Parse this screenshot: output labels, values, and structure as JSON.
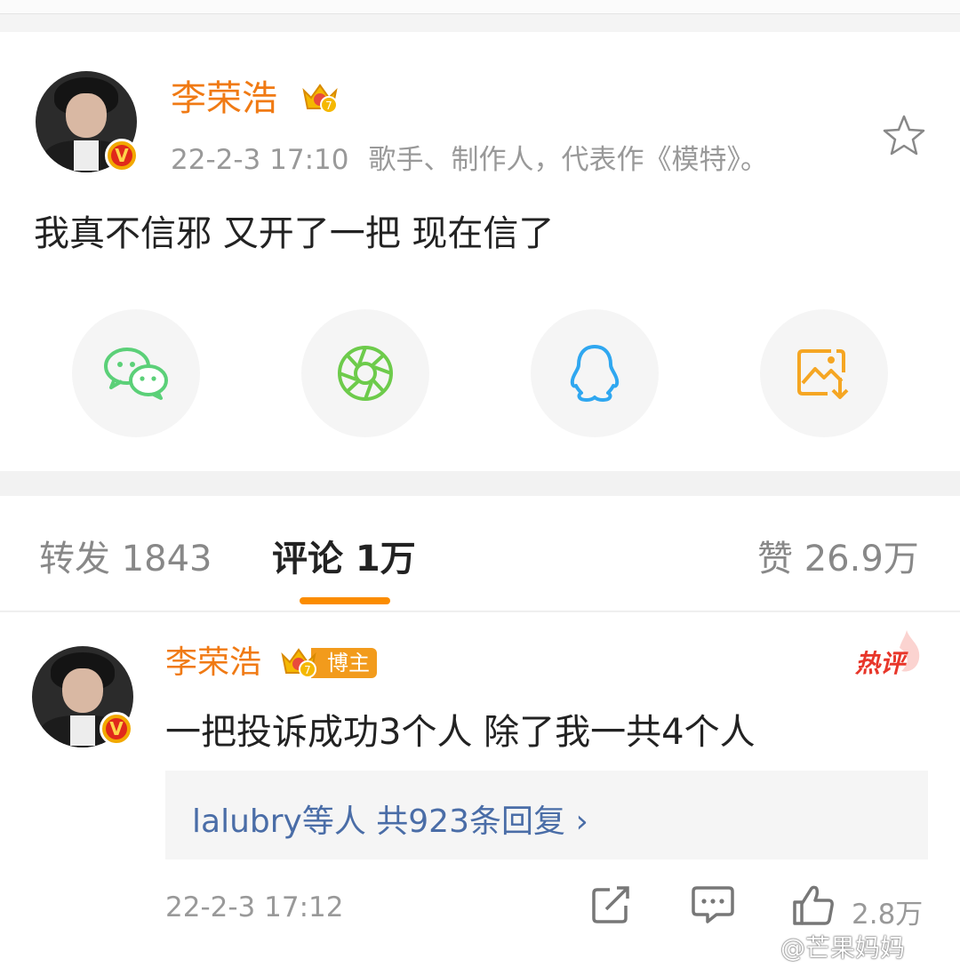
{
  "post": {
    "author": "李荣浩",
    "crown_level": "7",
    "time": "22-2-3 17:10",
    "bio": "歌手、制作人，代表作《模特》。",
    "text": "我真不信邪 又开了一把 现在信了",
    "verified_mark": "V"
  },
  "share": {
    "items": [
      {
        "icon": "wechat-icon",
        "color": "#5bd078"
      },
      {
        "icon": "moments-icon",
        "color": "#6dcb4b"
      },
      {
        "icon": "qq-icon",
        "color": "#2fa7f0"
      },
      {
        "icon": "save-image-icon",
        "color": "#f5a623"
      }
    ]
  },
  "tabs": {
    "repost": "转发 1843",
    "comments": "评论 1万",
    "likes": "赞 26.9万",
    "accent": "#fb8c00"
  },
  "comment": {
    "author": "李荣浩",
    "badge": "博主",
    "hot_label": "热评",
    "text": "一把投诉成功3个人 除了我一共4个人",
    "replies": "lalubry等人  共923条回复 ›",
    "time": "22-2-3 17:12",
    "likes": "2.8万",
    "crown_level": "7"
  },
  "watermark": "@芒果妈妈",
  "colors": {
    "name": "#f07a14",
    "link": "#4a6da7"
  }
}
